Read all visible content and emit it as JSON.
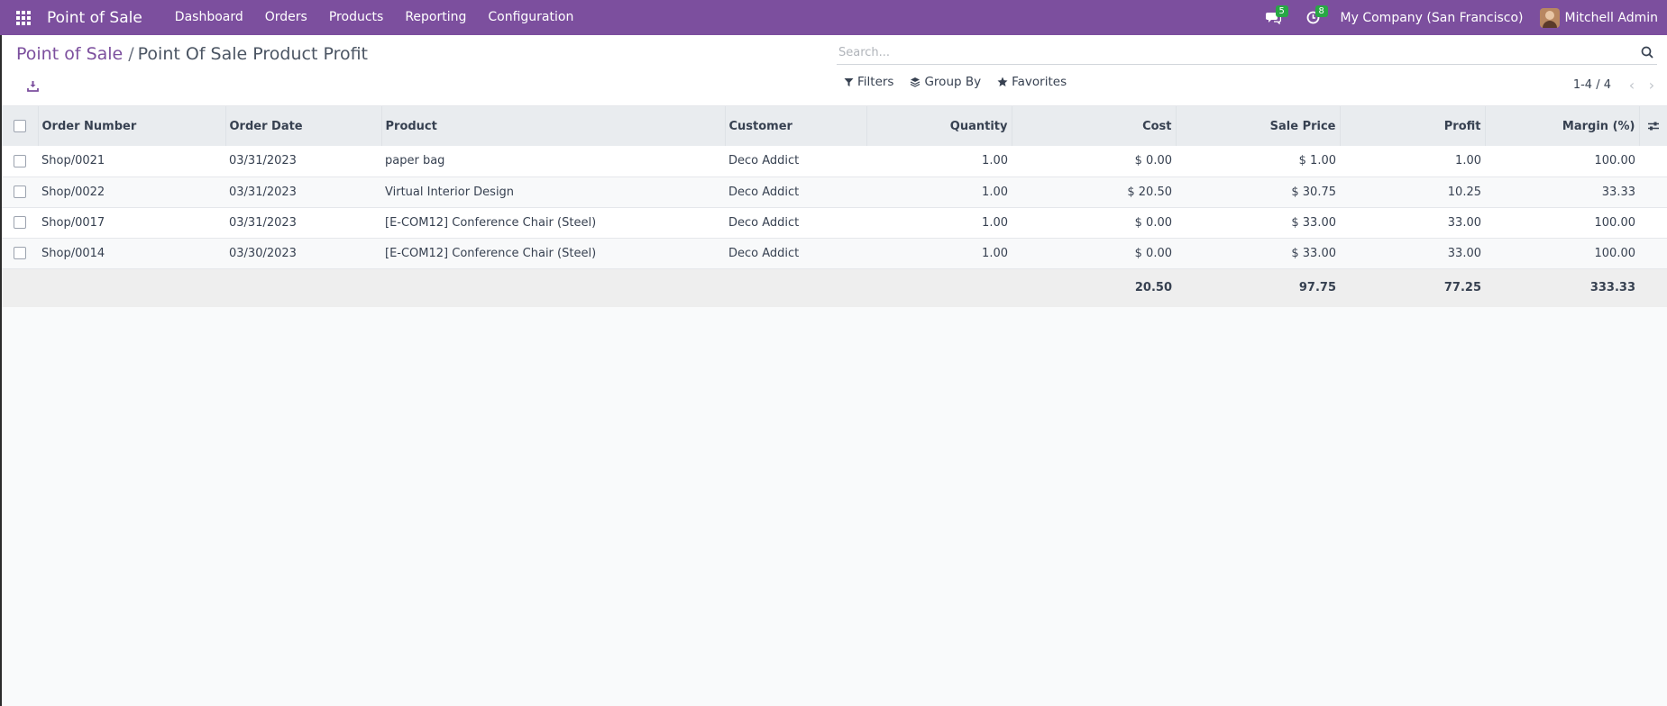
{
  "navbar": {
    "brand": "Point of Sale",
    "menu": [
      "Dashboard",
      "Orders",
      "Products",
      "Reporting",
      "Configuration"
    ],
    "messages_count": "5",
    "activities_count": "8",
    "company": "My Company (San Francisco)",
    "user": "Mitchell Admin",
    "accent_color": "#7c4f9e"
  },
  "breadcrumb": {
    "parent": "Point of Sale",
    "separator": "/",
    "current": "Point Of Sale Product Profit"
  },
  "search": {
    "placeholder": "Search..."
  },
  "filters": {
    "filters_label": "Filters",
    "group_by_label": "Group By",
    "favorites_label": "Favorites"
  },
  "pager": {
    "value": "1-4 / 4"
  },
  "table": {
    "columns": [
      "Order Number",
      "Order Date",
      "Product",
      "Customer",
      "Quantity",
      "Cost",
      "Sale Price",
      "Profit",
      "Margin (%)"
    ],
    "rows": [
      [
        "Shop/0021",
        "03/31/2023",
        "paper bag",
        "Deco Addict",
        "1.00",
        "$ 0.00",
        "$ 1.00",
        "1.00",
        "100.00"
      ],
      [
        "Shop/0022",
        "03/31/2023",
        "Virtual Interior Design",
        "Deco Addict",
        "1.00",
        "$ 20.50",
        "$ 30.75",
        "10.25",
        "33.33"
      ],
      [
        "Shop/0017",
        "03/31/2023",
        "[E-COM12] Conference Chair (Steel)",
        "Deco Addict",
        "1.00",
        "$ 0.00",
        "$ 33.00",
        "33.00",
        "100.00"
      ],
      [
        "Shop/0014",
        "03/30/2023",
        "[E-COM12] Conference Chair (Steel)",
        "Deco Addict",
        "1.00",
        "$ 0.00",
        "$ 33.00",
        "33.00",
        "100.00"
      ]
    ],
    "totals": {
      "cost": "20.50",
      "sale_price": "97.75",
      "profit": "77.25",
      "margin": "333.33"
    }
  }
}
